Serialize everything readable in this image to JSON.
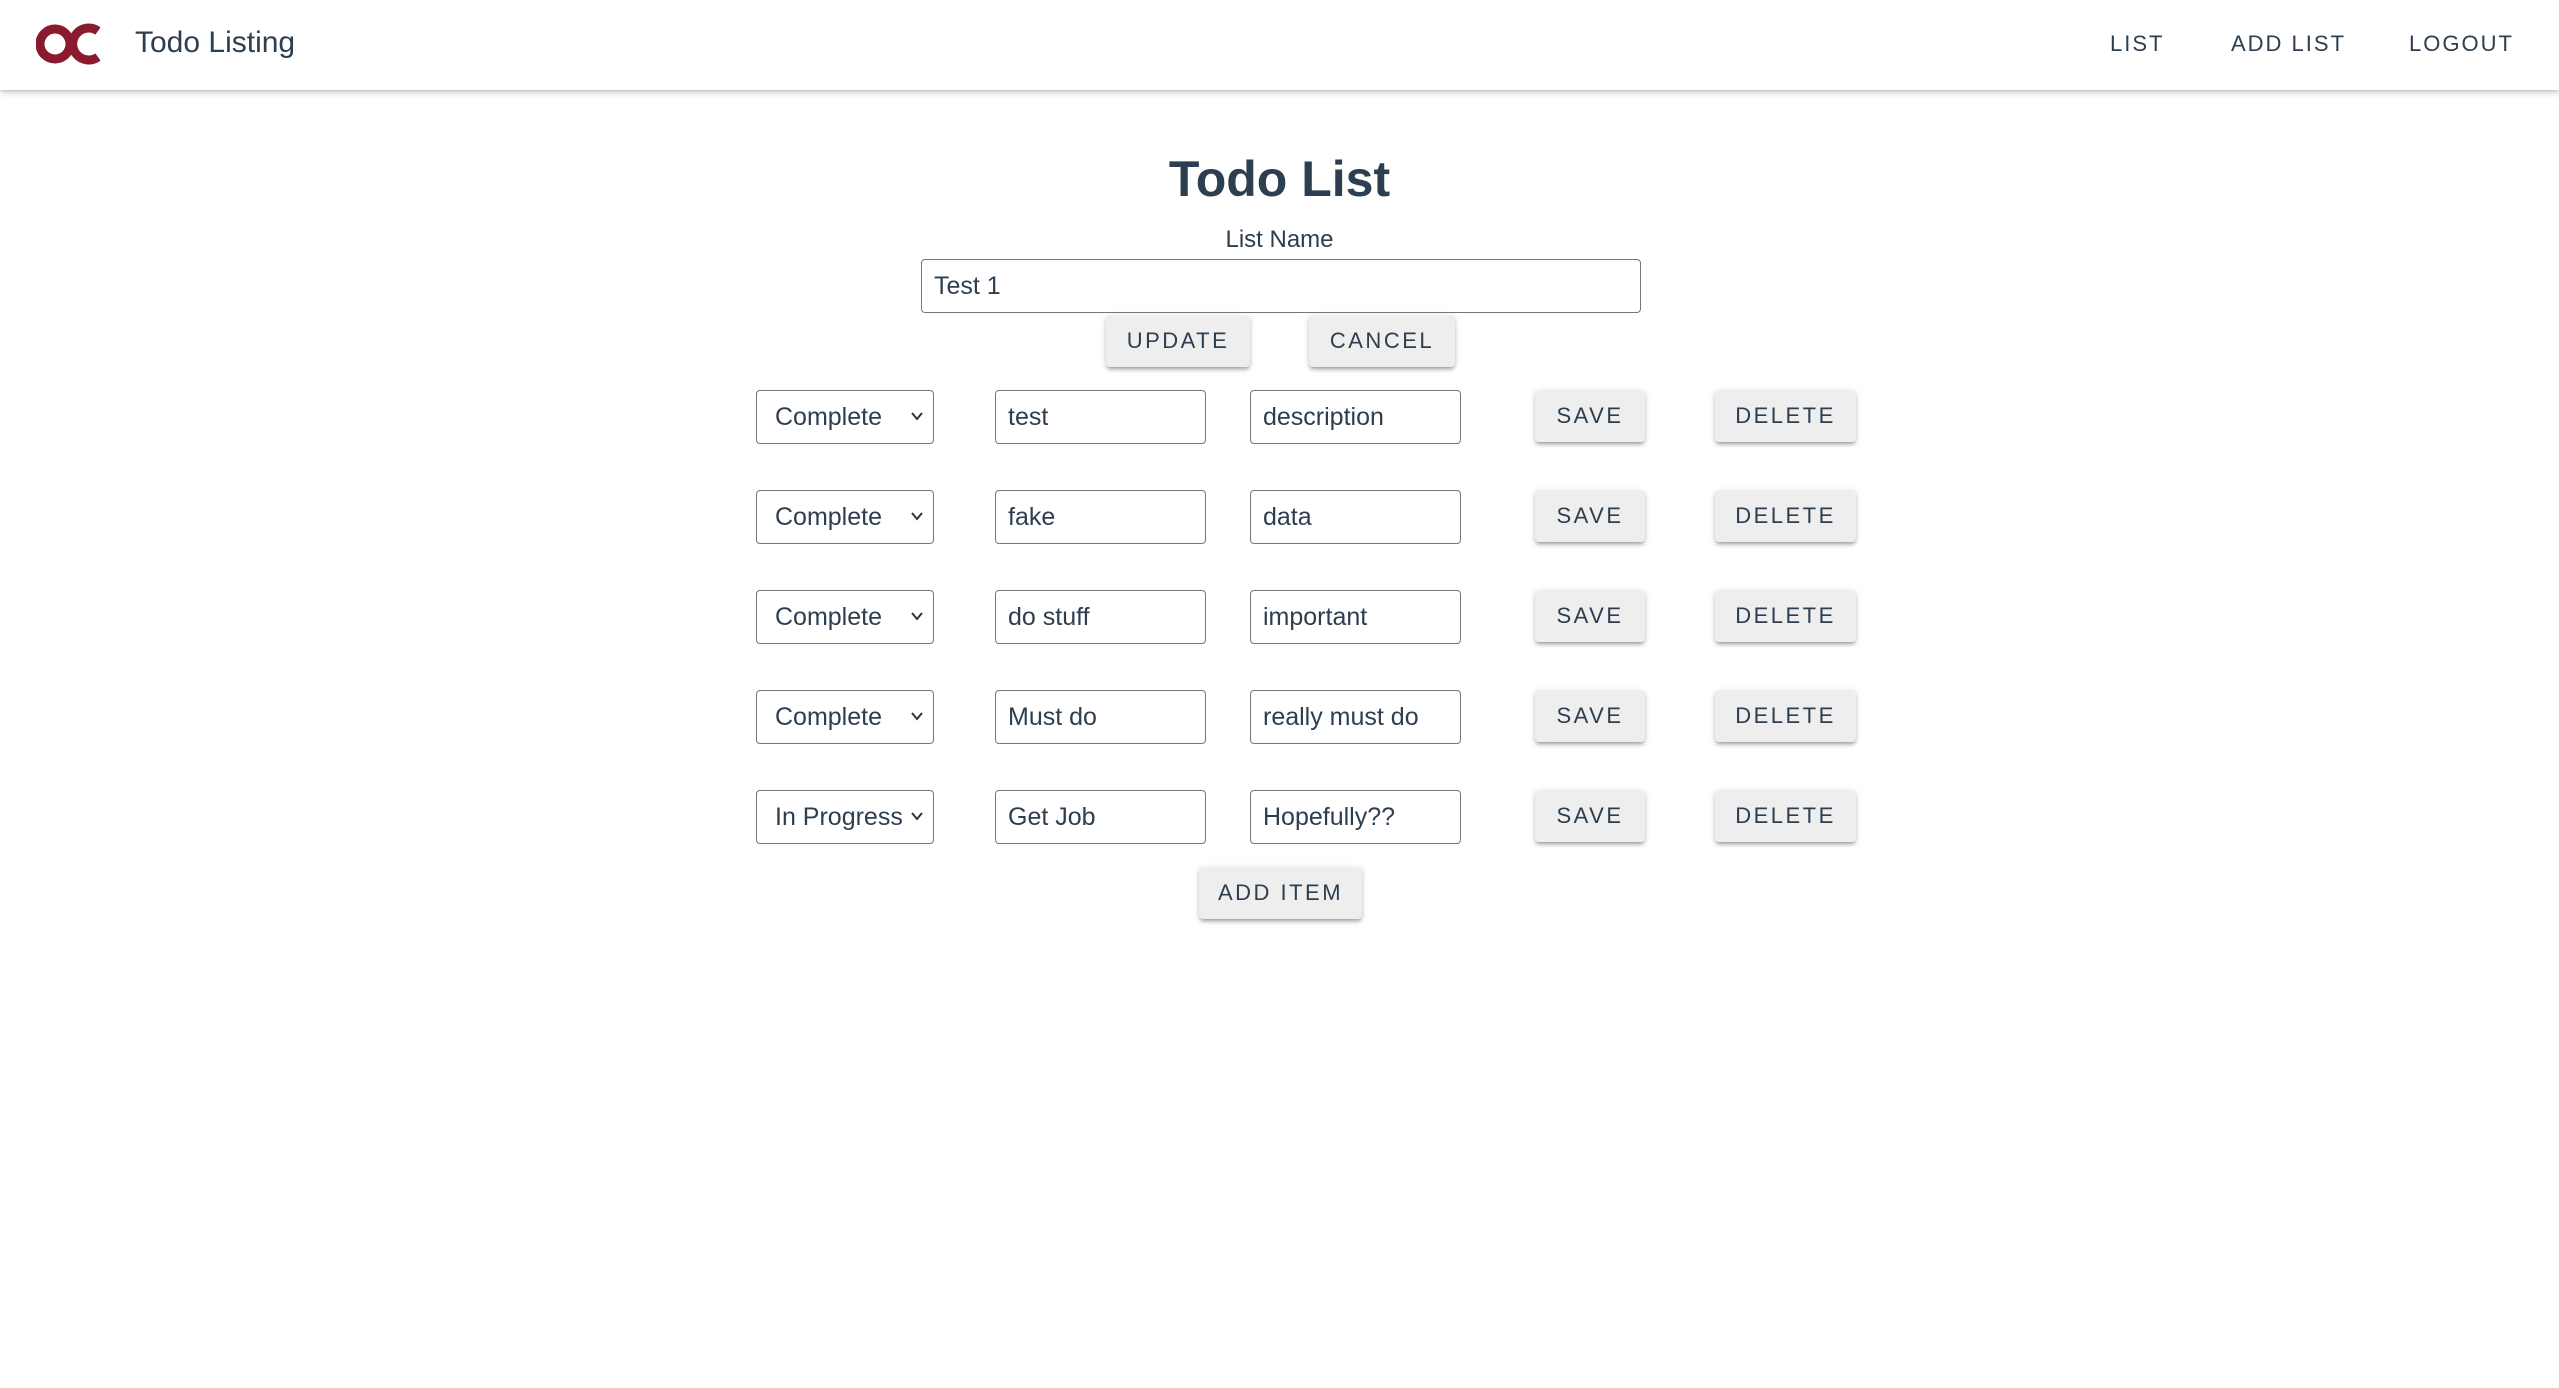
{
  "header": {
    "app_title": "Todo Listing",
    "brand_color": "#8a1a2e",
    "nav": {
      "list": "LIST",
      "add_list": "ADD LIST",
      "logout": "LOGOUT"
    }
  },
  "main": {
    "title": "Todo List",
    "list_name_label": "List Name",
    "list_name_value": "Test 1",
    "update_label": "UPDATE",
    "cancel_label": "CANCEL",
    "add_item_label": "ADD ITEM",
    "items": [
      {
        "status": "Complete",
        "name": "test",
        "description": "description",
        "save": "SAVE",
        "delete": "DELETE"
      },
      {
        "status": "Complete",
        "name": "fake",
        "description": "data",
        "save": "SAVE",
        "delete": "DELETE"
      },
      {
        "status": "Complete",
        "name": "do stuff",
        "description": "important",
        "save": "SAVE",
        "delete": "DELETE"
      },
      {
        "status": "Complete",
        "name": "Must do",
        "description": "really must do",
        "save": "SAVE",
        "delete": "DELETE"
      },
      {
        "status": "In Progress",
        "name": "Get Job",
        "description": "Hopefully??",
        "save": "SAVE",
        "delete": "DELETE"
      }
    ]
  }
}
